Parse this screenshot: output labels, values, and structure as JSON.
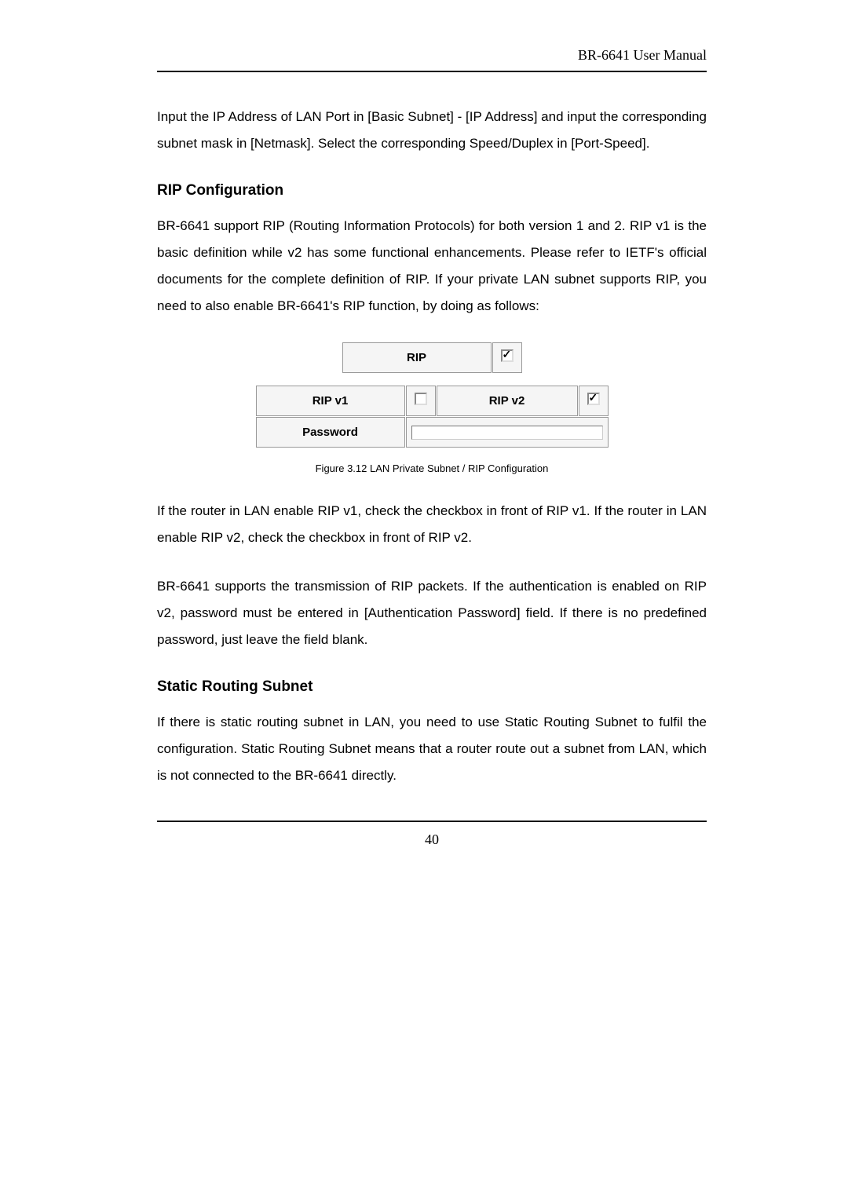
{
  "header": {
    "manual_title": "BR-6641 User Manual"
  },
  "content": {
    "intro_para": "Input the IP Address of LAN Port in [Basic Subnet] - [IP Address] and input the corresponding subnet mask in [Netmask]. Select the corresponding Speed/Duplex in [Port-Speed].",
    "rip_heading": "RIP Configuration",
    "rip_para": "BR-6641 support RIP (Routing Information Protocols) for both version 1 and 2. RIP v1 is the basic definition while v2 has some functional enhancements. Please refer to IETF's official documents for the complete definition of RIP. If your private LAN subnet supports RIP, you need to also enable BR-6641's RIP function, by doing as follows:",
    "figure_caption": "Figure 3.12    LAN Private Subnet / RIP Configuration",
    "rip_after_para1": "If the router in LAN enable RIP v1, check the checkbox in front of RIP v1. If the router in LAN enable RIP v2, check the checkbox in front of RIP v2.",
    "rip_after_para2": "BR-6641 supports the transmission of RIP packets. If the authentication is enabled on RIP v2, password must be entered in [Authentication Password] field. If there is no predefined password, just leave the field blank.",
    "static_heading": "Static Routing Subnet",
    "static_para": "If there is static routing subnet in LAN, you need to use Static Routing Subnet to fulfil the configuration. Static Routing Subnet means that a router route out a subnet from LAN, which is not connected to the BR-6641 directly."
  },
  "rip_form": {
    "rip_label": "RIP",
    "rip_checked": true,
    "ripv1_label": "RIP v1",
    "ripv1_checked": false,
    "ripv2_label": "RIP v2",
    "ripv2_checked": true,
    "password_label": "Password",
    "password_value": ""
  },
  "footer": {
    "page_number": "40"
  }
}
